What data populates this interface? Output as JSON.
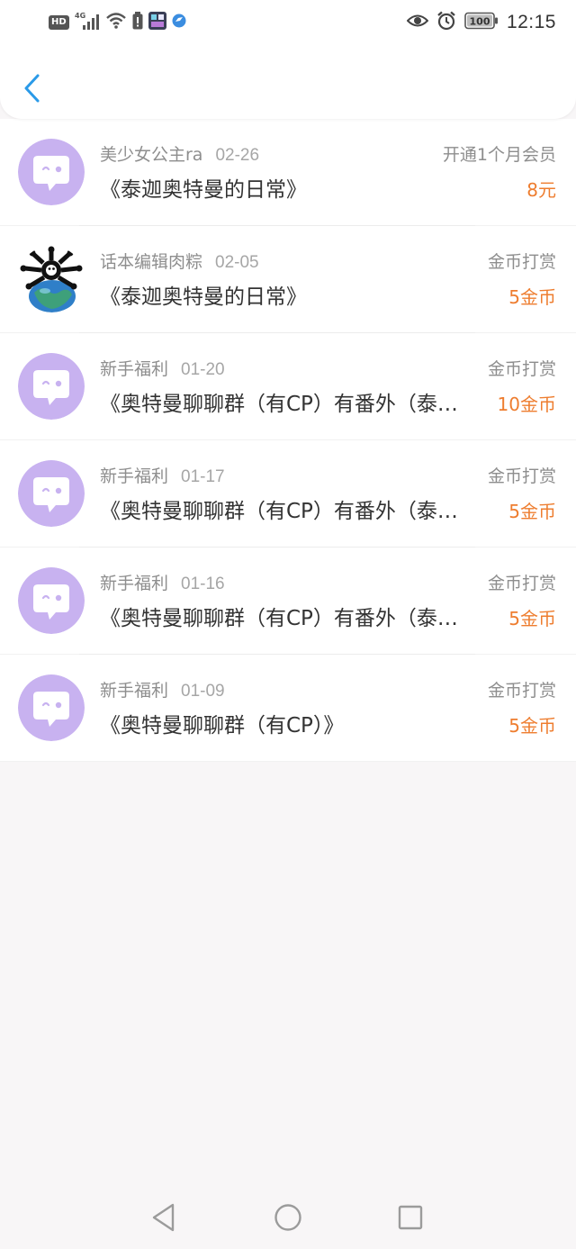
{
  "status_bar": {
    "left_icons": [
      "hd-icon",
      "4g-signal-icon",
      "wifi-icon",
      "battery-saver-icon",
      "app-notification-icon",
      "app-notification-icon"
    ],
    "hd_label": "HD",
    "network_label": "4G",
    "battery_level": "100",
    "time": "12:15",
    "right_icons": [
      "eye-icon",
      "alarm-icon",
      "battery-icon"
    ]
  },
  "header": {
    "back_icon": "chevron-left-icon",
    "accent_color": "#2a9ae8"
  },
  "colors": {
    "amount": "#ee7d2f",
    "avatar_bg": "#c8b2f0",
    "secondary_text": "#8e8e8e",
    "title_text": "#333333"
  },
  "records": [
    {
      "user": "美少女公主ra",
      "date": "02-26",
      "title": "《泰迦奥特曼的日常》",
      "type": "开通1个月会员",
      "amount": "8元",
      "avatar": "chat-bubble-icon"
    },
    {
      "user": "话本编辑肉粽",
      "date": "02-05",
      "title": "《泰迦奥特曼的日常》",
      "type": "金币打赏",
      "amount": "5金币",
      "avatar": "custom-avatar-image"
    },
    {
      "user": "新手福利",
      "date": "01-20",
      "title": "《奥特曼聊聊群（有CP）有番外（泰…",
      "type": "金币打赏",
      "amount": "10金币",
      "avatar": "chat-bubble-icon"
    },
    {
      "user": "新手福利",
      "date": "01-17",
      "title": "《奥特曼聊聊群（有CP）有番外（泰…",
      "type": "金币打赏",
      "amount": "5金币",
      "avatar": "chat-bubble-icon"
    },
    {
      "user": "新手福利",
      "date": "01-16",
      "title": "《奥特曼聊聊群（有CP）有番外（泰…",
      "type": "金币打赏",
      "amount": "5金币",
      "avatar": "chat-bubble-icon"
    },
    {
      "user": "新手福利",
      "date": "01-09",
      "title": "《奥特曼聊聊群（有CP）》",
      "type": "金币打赏",
      "amount": "5金币",
      "avatar": "chat-bubble-icon"
    }
  ],
  "nav_bar": {
    "icons": [
      "nav-back-icon",
      "nav-home-icon",
      "nav-recents-icon"
    ]
  }
}
